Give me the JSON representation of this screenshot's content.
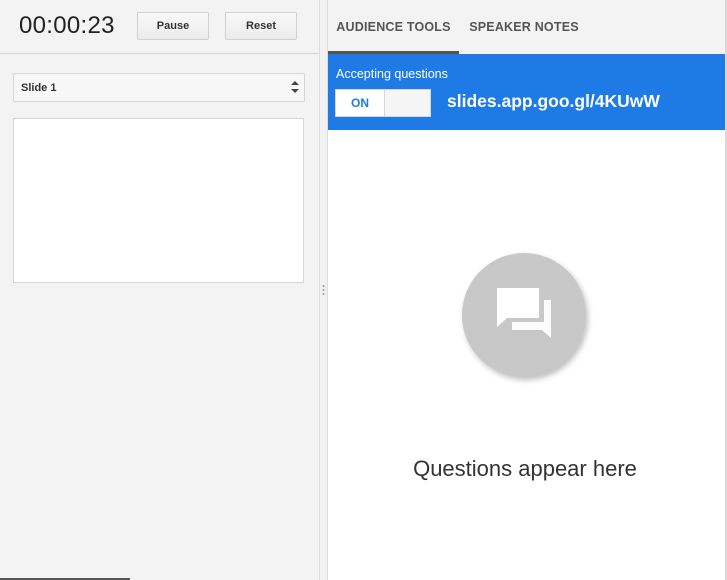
{
  "presenter": {
    "timer": "00:00:23",
    "pause_label": "Pause",
    "reset_label": "Reset",
    "slide_select_value": "Slide 1"
  },
  "tabs": [
    {
      "label": "AUDIENCE TOOLS",
      "active": true
    },
    {
      "label": "SPEAKER NOTES",
      "active": false
    }
  ],
  "qa": {
    "accepting_label": "Accepting questions",
    "toggle_state": "ON",
    "link": "slides.app.goo.gl/4KUwW"
  },
  "empty_state": {
    "icon": "question-answer-icon",
    "text": "Questions appear here"
  },
  "colors": {
    "accent": "#1e7be6",
    "panel_bg": "#f3f3f3",
    "empty_icon_bg": "#c8c8c8"
  }
}
